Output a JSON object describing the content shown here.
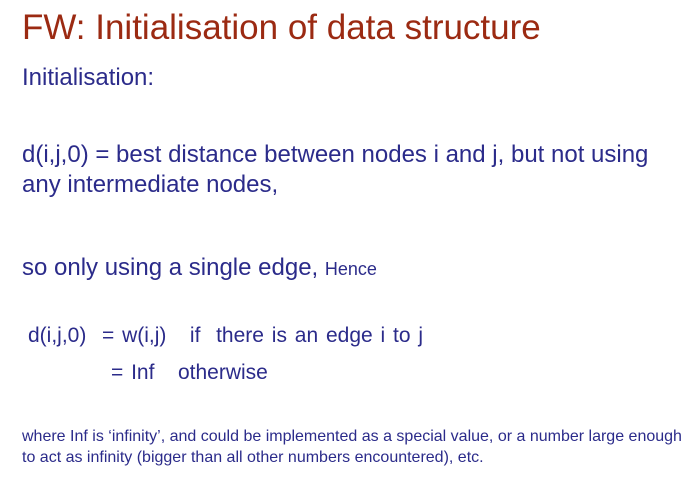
{
  "slide": {
    "title": "FW: Initialisation of data structure",
    "subtitle": "Initialisation:",
    "paragraph1": "d(i,j,0) = best distance between nodes i and j, but not using any intermediate nodes,",
    "paragraph2_main": "so only using a single edge, ",
    "paragraph2_small": "Hence",
    "formula_line1": "d(i,j,0)  = w(i,j)   if  there is an edge i to j",
    "formula_line2": "= Inf   otherwise",
    "footnote": "where Inf is ‘infinity’, and could be implemented as a special value, or a number large enough to act as infinity (bigger than all other numbers encountered), etc."
  },
  "colors": {
    "title": "#9b2a12",
    "body_text": "#2b2b8a",
    "background": "#ffffff"
  }
}
